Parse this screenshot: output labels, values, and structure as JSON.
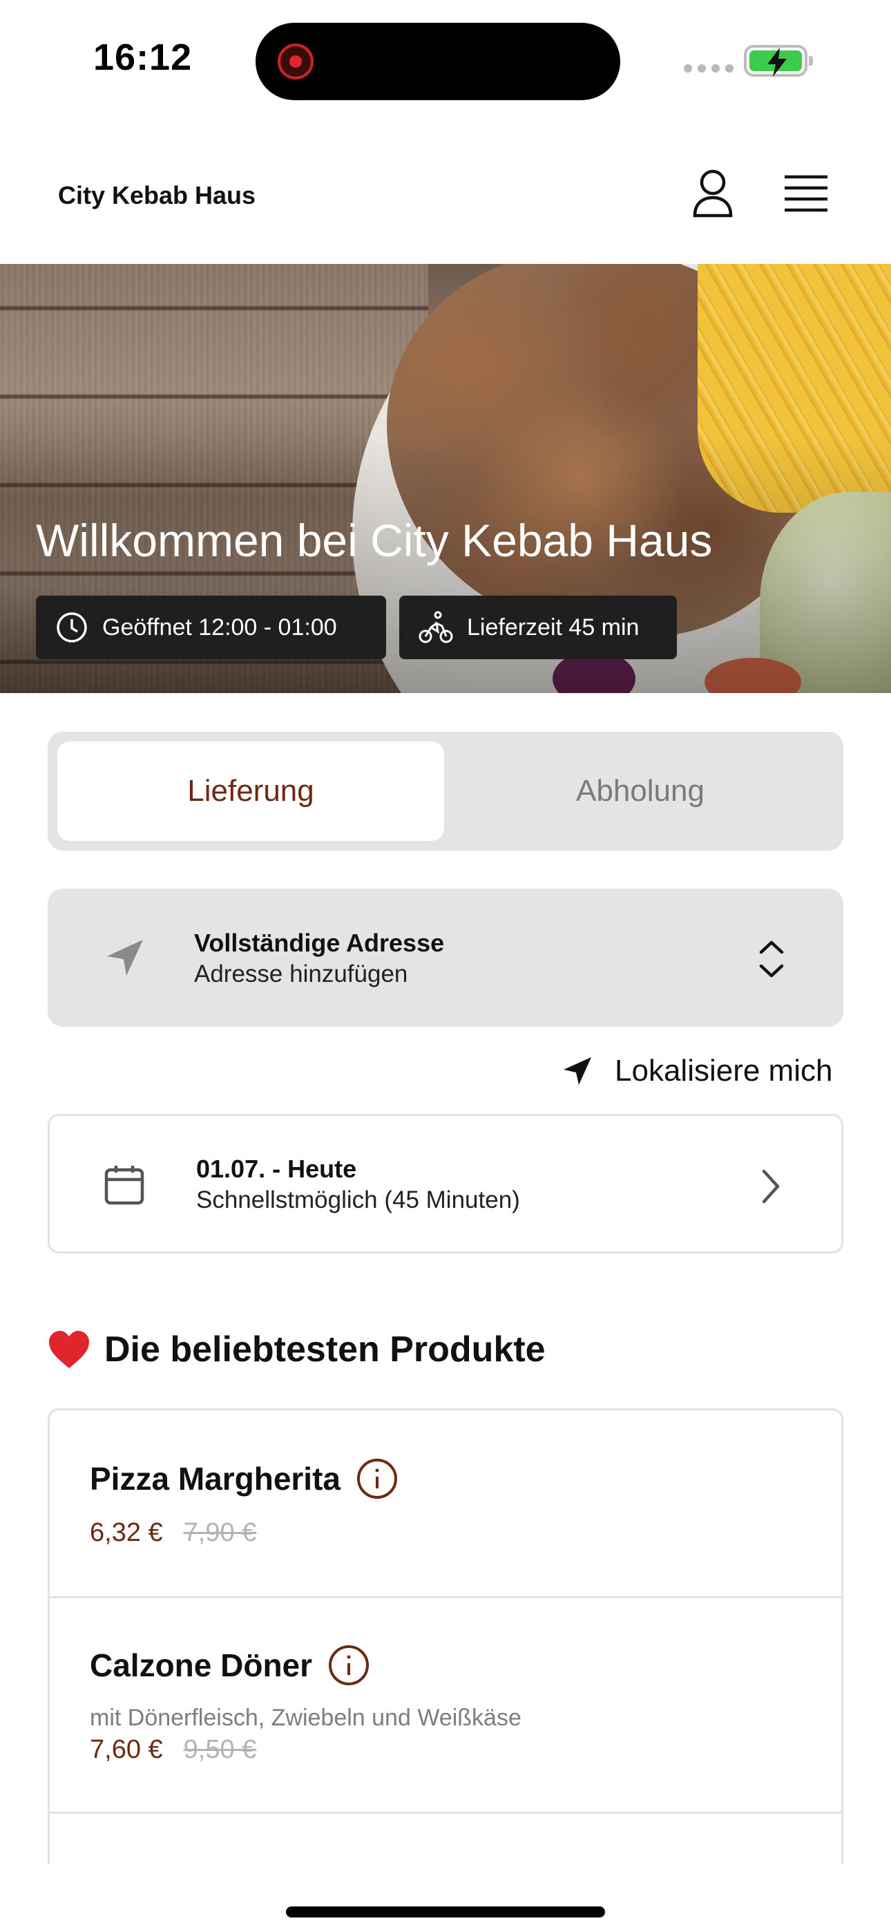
{
  "status_bar": {
    "time": "16:12"
  },
  "header": {
    "brand": "City Kebab Haus"
  },
  "hero": {
    "title": "Willkommen bei City Kebab Haus",
    "opening_hours": "Geöffnet 12:00 - 01:00",
    "delivery_time": "Lieferzeit 45 min"
  },
  "order_mode": {
    "options": [
      "Lieferung",
      "Abholung"
    ],
    "selected": "Lieferung"
  },
  "address": {
    "title": "Vollständige Adresse",
    "subtitle": "Adresse hinzufügen",
    "locate_label": "Lokalisiere mich"
  },
  "schedule": {
    "date": "01.07. - Heute",
    "time": "Schnellstmöglich (45 Minuten)"
  },
  "popular": {
    "title": "Die beliebtesten Produkte",
    "products": [
      {
        "name": "Pizza Margherita",
        "description": "",
        "price": "6,32 €",
        "old_price": "7,90 €"
      },
      {
        "name": "Calzone Döner",
        "description": "mit Dönerfleisch, Zwiebeln und Weißkäse",
        "price": "7,60 €",
        "old_price": "9,50 €"
      }
    ]
  },
  "colors": {
    "accent": "#6b2a11",
    "chip_bg": "#1f1f1f",
    "segment_bg": "#e4e4e4",
    "battery": "#3ccb4a",
    "heart": "#e0262c"
  },
  "icons": [
    "record-icon",
    "signal-icon",
    "battery-icon",
    "user-icon",
    "menu-icon",
    "clock-icon",
    "bike-icon",
    "navigation-arrow-icon",
    "chevron-up-down-icon",
    "location-arrow-icon",
    "calendar-icon",
    "chevron-right-icon",
    "heart-icon",
    "info-icon"
  ]
}
